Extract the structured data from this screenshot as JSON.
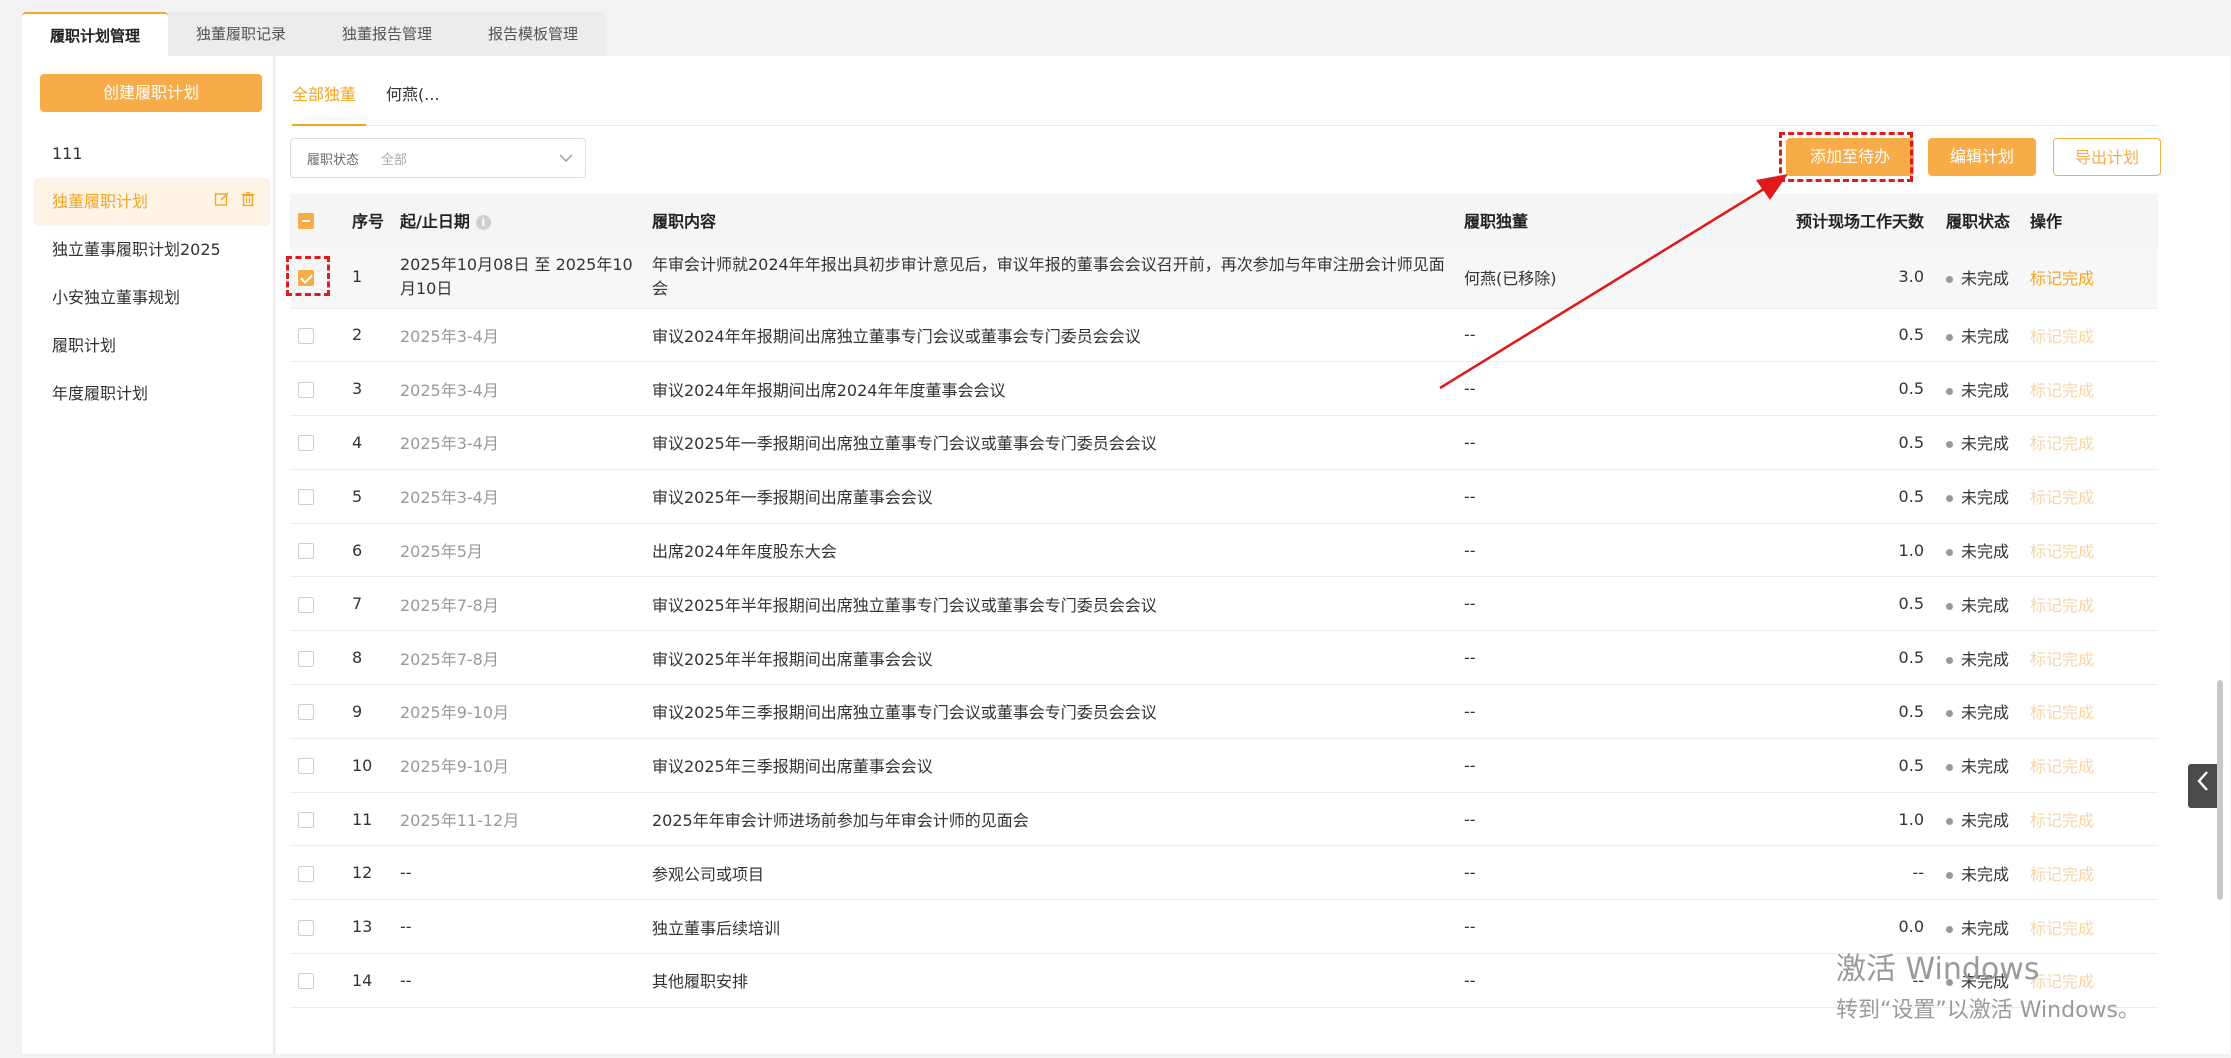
{
  "top_tabs": [
    "履职计划管理",
    "独董履职记录",
    "独董报告管理",
    "报告模板管理"
  ],
  "sidebar": {
    "create_label": "创建履职计划",
    "items": [
      {
        "label": "111"
      },
      {
        "label": "独董履职计划"
      },
      {
        "label": "独立董事履职计划2025"
      },
      {
        "label": "小安独立董事规划"
      },
      {
        "label": "履职计划"
      },
      {
        "label": "年度履职计划"
      }
    ]
  },
  "sub_tabs": [
    "全部独董",
    "何燕(..."
  ],
  "filter": {
    "label": "履职状态",
    "value": "全部"
  },
  "buttons": {
    "add_todo": "添加至待办",
    "edit_plan": "编辑计划",
    "export_plan": "导出计划"
  },
  "table": {
    "headers": {
      "seq": "序号",
      "date": "起/止日期",
      "content": "履职内容",
      "director": "履职独董",
      "days": "预计现场工作天数",
      "status": "履职状态",
      "action": "操作"
    },
    "rows": [
      {
        "seq": "1",
        "date": "2025年10月08日 至 2025年10月10日",
        "content": "年审会计师就2024年年报出具初步审计意见后，审议年报的董事会会议召开前，再次参加与年审注册会计师见面会",
        "director": "何燕(已移除)",
        "days": "3.0",
        "status": "未完成",
        "action": "标记完成"
      },
      {
        "seq": "2",
        "date": "2025年3-4月",
        "content": "审议2024年年报期间出席独立董事专门会议或董事会专门委员会会议",
        "director": "--",
        "days": "0.5",
        "status": "未完成",
        "action": "标记完成"
      },
      {
        "seq": "3",
        "date": "2025年3-4月",
        "content": "审议2024年年报期间出席2024年年度董事会会议",
        "director": "--",
        "days": "0.5",
        "status": "未完成",
        "action": "标记完成"
      },
      {
        "seq": "4",
        "date": "2025年3-4月",
        "content": "审议2025年一季报期间出席独立董事专门会议或董事会专门委员会会议",
        "director": "--",
        "days": "0.5",
        "status": "未完成",
        "action": "标记完成"
      },
      {
        "seq": "5",
        "date": "2025年3-4月",
        "content": "审议2025年一季报期间出席董事会会议",
        "director": "--",
        "days": "0.5",
        "status": "未完成",
        "action": "标记完成"
      },
      {
        "seq": "6",
        "date": "2025年5月",
        "content": "出席2024年年度股东大会",
        "director": "--",
        "days": "1.0",
        "status": "未完成",
        "action": "标记完成"
      },
      {
        "seq": "7",
        "date": "2025年7-8月",
        "content": "审议2025年半年报期间出席独立董事专门会议或董事会专门委员会会议",
        "director": "--",
        "days": "0.5",
        "status": "未完成",
        "action": "标记完成"
      },
      {
        "seq": "8",
        "date": "2025年7-8月",
        "content": "审议2025年半年报期间出席董事会会议",
        "director": "--",
        "days": "0.5",
        "status": "未完成",
        "action": "标记完成"
      },
      {
        "seq": "9",
        "date": "2025年9-10月",
        "content": "审议2025年三季报期间出席独立董事专门会议或董事会专门委员会会议",
        "director": "--",
        "days": "0.5",
        "status": "未完成",
        "action": "标记完成"
      },
      {
        "seq": "10",
        "date": "2025年9-10月",
        "content": "审议2025年三季报期间出席董事会会议",
        "director": "--",
        "days": "0.5",
        "status": "未完成",
        "action": "标记完成"
      },
      {
        "seq": "11",
        "date": "2025年11-12月",
        "content": "2025年年审会计师进场前参加与年审会计师的见面会",
        "director": "--",
        "days": "1.0",
        "status": "未完成",
        "action": "标记完成"
      },
      {
        "seq": "12",
        "date": "--",
        "content": "参观公司或项目",
        "director": "--",
        "days": "--",
        "status": "未完成",
        "action": "标记完成"
      },
      {
        "seq": "13",
        "date": "--",
        "content": "独立董事后续培训",
        "director": "--",
        "days": "0.0",
        "status": "未完成",
        "action": "标记完成"
      },
      {
        "seq": "14",
        "date": "--",
        "content": "其他履职安排",
        "director": "--",
        "days": "--",
        "status": "未完成",
        "action": "标记完成"
      }
    ]
  },
  "watermark": {
    "line1": "激活 Windows",
    "line2": "转到“设置”以激活 Windows。"
  },
  "colors": {
    "accent": "#f8ac48",
    "annotation": "#e0191b"
  }
}
